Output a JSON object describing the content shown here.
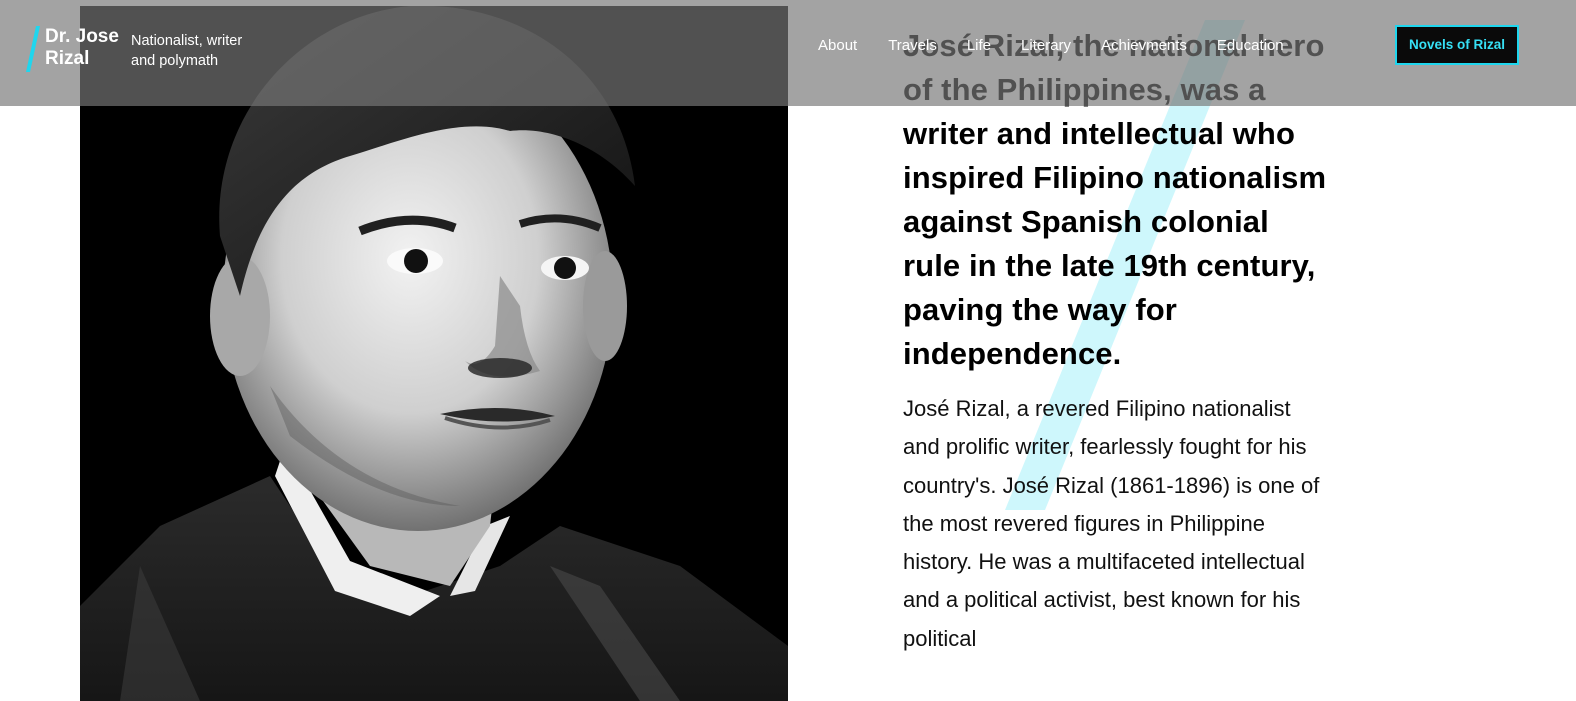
{
  "brand": {
    "name": "Dr. Jose\nRizal",
    "tagline": "Nationalist, writer and polymath"
  },
  "nav": {
    "items": [
      "About",
      "Travels",
      "Life",
      "Literary",
      "Achievments",
      "Education"
    ],
    "cta_label": "Novels of Rizal"
  },
  "hero": {
    "image_alt": "Portrait of José Rizal",
    "lead": "José Rizal, the national hero of the Philippines, was a writer and intellectual who inspired Filipino nationalism against Spanish colonial rule in the late 19th century, paving the way for independence.",
    "body": "José Rizal, a revered Filipino nationalist and prolific writer, fearlessly fought for his country's. José Rizal (1861-1896) is one of the most revered figures in Philippine history. He was a multifaceted intellectual and a political activist, best known for his political"
  },
  "colors": {
    "accent": "#1fd6ee",
    "header_overlay": "#787878",
    "text": "#000000"
  },
  "icons": {
    "brand_mark": "slash-mark-icon"
  }
}
